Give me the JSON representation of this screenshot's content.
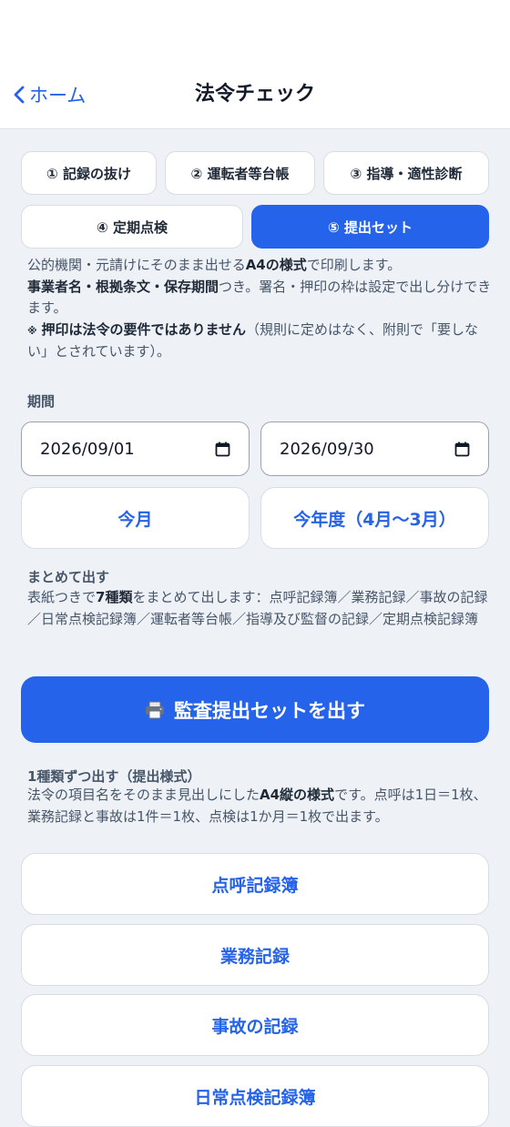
{
  "header": {
    "back_label": "ホーム",
    "title": "法令チェック"
  },
  "tabs": [
    {
      "label": "① 記録の抜け",
      "active": false
    },
    {
      "label": "② 運転者等台帳",
      "active": false
    },
    {
      "label": "③ 指導・適性診断",
      "active": false
    },
    {
      "label": "④ 定期点検",
      "active": false
    },
    {
      "label": "⑤ 提出セット",
      "active": true
    }
  ],
  "intro": {
    "l1a": "公的機関・元請けにそのまま出せる",
    "l1b": "A4の様式",
    "l1c": "で印刷します。",
    "l2a": "事業者名・根拠条文・保存期間",
    "l2b": "つき。署名・押印の枠は設定で出し分けできます。",
    "note_mark": "※",
    "l3a": "押印は法令の要件ではありません",
    "l3b": "（規則に定めはなく、附則で「要しない」とされています）。"
  },
  "period": {
    "label": "期間",
    "start": "2026/09/01",
    "end": "2026/09/30",
    "this_month": "今月",
    "this_fiscal_year": "今年度（4月〜3月）"
  },
  "bulk": {
    "heading": "まとめて出す",
    "desc_a": "表紙つきで",
    "desc_b": "7種類",
    "desc_c": "をまとめて出します：点呼記録簿／業務記録／事故の記録／日常点検記録簿／運転者等台帳／指導及び監督の記録／定期点検記録簿",
    "button": "監査提出セットを出す"
  },
  "single": {
    "heading": "1種類ずつ出す（提出様式）",
    "desc_a": "法令の項目名をそのまま見出しにした",
    "desc_b": "A4縦の様式",
    "desc_c": "です。点呼は1日＝1枚、業務記録と事故は1件＝1枚、点検は1か月＝1枚で出ます。",
    "forms": [
      "点呼記録簿",
      "業務記録",
      "事故の記録",
      "日常点検記録簿"
    ]
  },
  "colors": {
    "accent": "#2563eb",
    "background": "#eef2f7"
  }
}
